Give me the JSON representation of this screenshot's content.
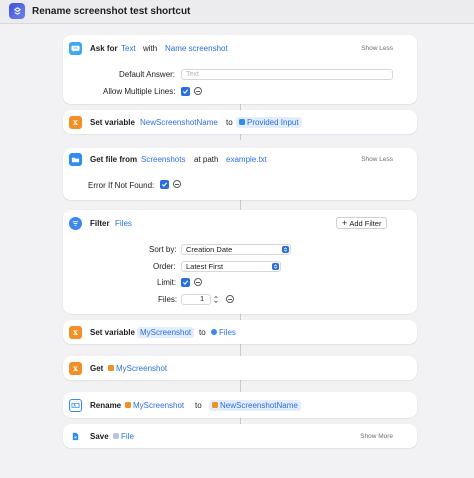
{
  "window": {
    "title": "Rename screenshot test shortcut",
    "app_icon": "shortcuts-icon"
  },
  "colors": {
    "accent": "#2a6ee0",
    "var_bg": "#e3edfb",
    "orange": "#f28f25",
    "blue_icon": "#2f8cf2",
    "ask_icon": "#3fa8f3",
    "filter_icon": "#3b86f0"
  },
  "actions": {
    "ask": {
      "verb": "Ask for",
      "type": "Text",
      "with": "with",
      "prompt": "Name screenshot",
      "toggle": "Show Less",
      "default_answer_label": "Default Answer:",
      "default_answer_placeholder": "Text",
      "multiple_lines_label": "Allow Multiple Lines:"
    },
    "set_var_1": {
      "verb": "Set variable",
      "name": "NewScreenshotName",
      "to": "to",
      "value": "Provided Input"
    },
    "get_file": {
      "verb": "Get file from",
      "folder": "Screenshots",
      "at_path": "at path",
      "path": "example.txt",
      "toggle": "Show Less",
      "error_label": "Error If Not Found:"
    },
    "filter": {
      "verb": "Filter",
      "source": "Files",
      "add_filter": "Add Filter",
      "sort_label": "Sort by:",
      "sort_value": "Creation Date",
      "order_label": "Order:",
      "order_value": "Latest First",
      "limit_label": "Limit:",
      "files_label": "Files:",
      "files_value": "1"
    },
    "set_var_2": {
      "verb": "Set variable",
      "name": "MyScreenshot",
      "to": "to",
      "value": "Files"
    },
    "get": {
      "verb": "Get",
      "value": "MyScreenshot"
    },
    "rename": {
      "verb": "Rename",
      "item": "MyScreenshot",
      "to": "to",
      "new_name": "NewScreenshotName"
    },
    "save": {
      "verb": "Save",
      "value": "File",
      "toggle": "Show More"
    }
  }
}
